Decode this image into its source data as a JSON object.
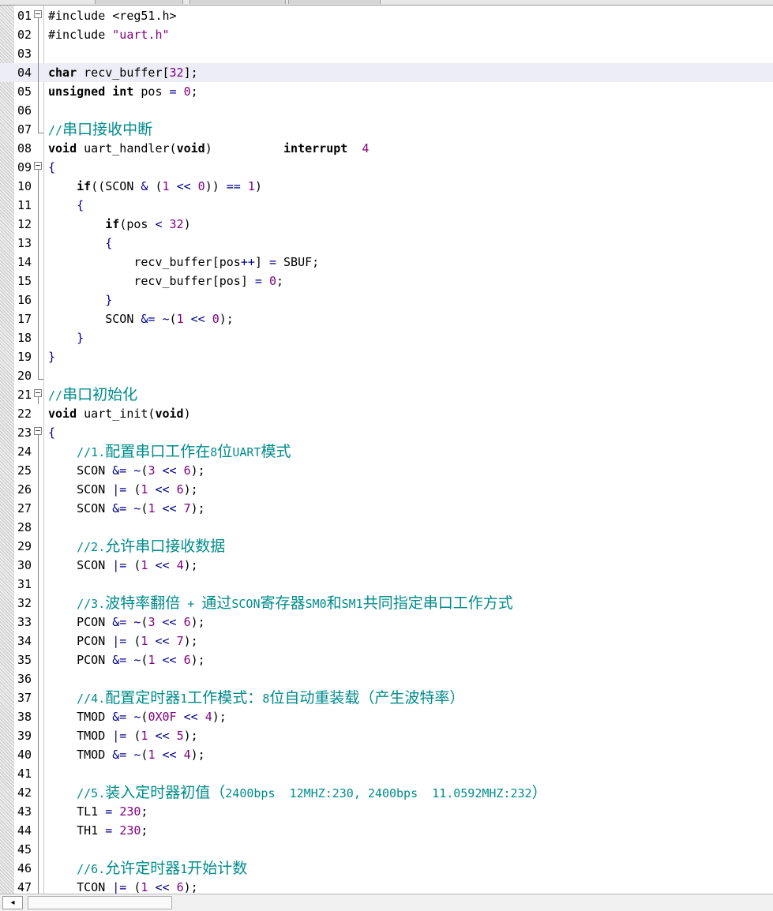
{
  "editor": {
    "lines": [
      {
        "n": "01",
        "fold": "box",
        "tokens": [
          [
            "#include",
            "pp"
          ],
          [
            " <reg51.h>",
            "pp"
          ]
        ]
      },
      {
        "n": "02",
        "fold": "line",
        "tokens": [
          [
            "#include",
            "pp"
          ],
          [
            " ",
            ""
          ],
          [
            "\"uart.h\"",
            "s"
          ]
        ]
      },
      {
        "n": "03",
        "fold": "line",
        "tokens": []
      },
      {
        "n": "04",
        "fold": "line",
        "hl": true,
        "tokens": [
          [
            "char",
            "k"
          ],
          [
            " recv_buffer[",
            ""
          ],
          [
            "32",
            "n"
          ],
          [
            "];",
            ""
          ]
        ]
      },
      {
        "n": "05",
        "fold": "line",
        "tokens": [
          [
            "unsigned",
            "k"
          ],
          [
            " ",
            ""
          ],
          [
            "int",
            "k"
          ],
          [
            " pos ",
            ""
          ],
          [
            "=",
            "o"
          ],
          [
            " ",
            ""
          ],
          [
            "0",
            "n"
          ],
          [
            ";",
            ""
          ]
        ]
      },
      {
        "n": "06",
        "fold": "line",
        "tokens": []
      },
      {
        "n": "07",
        "fold": "end",
        "tokens": [
          [
            "//串口接收中断",
            "c"
          ]
        ]
      },
      {
        "n": "08",
        "fold": "none",
        "tokens": [
          [
            "void",
            "k"
          ],
          [
            " uart_handler(",
            ""
          ],
          [
            "void",
            "k"
          ],
          [
            ")          ",
            ""
          ],
          [
            "interrupt",
            "k"
          ],
          [
            "  ",
            ""
          ],
          [
            "4",
            "n"
          ]
        ]
      },
      {
        "n": "09",
        "fold": "box",
        "tokens": [
          [
            "{",
            "o"
          ]
        ]
      },
      {
        "n": "10",
        "fold": "line",
        "tokens": [
          [
            "    ",
            ""
          ],
          [
            "if",
            "k"
          ],
          [
            "((SCON ",
            ""
          ],
          [
            "&",
            "o"
          ],
          [
            " (",
            ""
          ],
          [
            "1",
            "n"
          ],
          [
            " ",
            ""
          ],
          [
            "<<",
            "o"
          ],
          [
            " ",
            ""
          ],
          [
            "0",
            "n"
          ],
          [
            ")) ",
            ""
          ],
          [
            "==",
            "o"
          ],
          [
            " ",
            ""
          ],
          [
            "1",
            "n"
          ],
          [
            ")",
            ""
          ]
        ]
      },
      {
        "n": "11",
        "fold": "line",
        "tokens": [
          [
            "    ",
            ""
          ],
          [
            "{",
            "o"
          ]
        ]
      },
      {
        "n": "12",
        "fold": "line",
        "tokens": [
          [
            "        ",
            ""
          ],
          [
            "if",
            "k"
          ],
          [
            "(pos ",
            ""
          ],
          [
            "<",
            "o"
          ],
          [
            " ",
            ""
          ],
          [
            "32",
            "n"
          ],
          [
            ")",
            ""
          ]
        ]
      },
      {
        "n": "13",
        "fold": "line",
        "tokens": [
          [
            "        ",
            ""
          ],
          [
            "{",
            "o"
          ]
        ]
      },
      {
        "n": "14",
        "fold": "line",
        "tokens": [
          [
            "            recv_buffer[pos",
            ""
          ],
          [
            "++",
            "o"
          ],
          [
            "] ",
            ""
          ],
          [
            "=",
            "o"
          ],
          [
            " SBUF;",
            ""
          ]
        ]
      },
      {
        "n": "15",
        "fold": "line",
        "tokens": [
          [
            "            recv_buffer[pos] ",
            ""
          ],
          [
            "=",
            "o"
          ],
          [
            " ",
            ""
          ],
          [
            "0",
            "n"
          ],
          [
            ";",
            ""
          ]
        ]
      },
      {
        "n": "16",
        "fold": "line",
        "tokens": [
          [
            "        ",
            ""
          ],
          [
            "}",
            "o"
          ]
        ]
      },
      {
        "n": "17",
        "fold": "line",
        "tokens": [
          [
            "        SCON ",
            ""
          ],
          [
            "&=",
            "o"
          ],
          [
            " ",
            ""
          ],
          [
            "~",
            "o"
          ],
          [
            "(",
            ""
          ],
          [
            "1",
            "n"
          ],
          [
            " ",
            ""
          ],
          [
            "<<",
            "o"
          ],
          [
            " ",
            ""
          ],
          [
            "0",
            "n"
          ],
          [
            ");",
            ""
          ]
        ]
      },
      {
        "n": "18",
        "fold": "line",
        "tokens": [
          [
            "    ",
            ""
          ],
          [
            "}",
            "o"
          ]
        ]
      },
      {
        "n": "19",
        "fold": "line",
        "tokens": [
          [
            "}",
            "o"
          ]
        ]
      },
      {
        "n": "20",
        "fold": "end",
        "tokens": []
      },
      {
        "n": "21",
        "fold": "box",
        "tokens": [
          [
            "//串口初始化",
            "c"
          ]
        ]
      },
      {
        "n": "22",
        "fold": "none",
        "tokens": [
          [
            "void",
            "k"
          ],
          [
            " uart_init(",
            ""
          ],
          [
            "void",
            "k"
          ],
          [
            ")",
            ""
          ]
        ]
      },
      {
        "n": "23",
        "fold": "box",
        "tokens": [
          [
            "{",
            "o"
          ]
        ]
      },
      {
        "n": "24",
        "fold": "line",
        "tokens": [
          [
            "    ",
            ""
          ],
          [
            "//1.配置串口工作在8位UART模式",
            "c"
          ]
        ]
      },
      {
        "n": "25",
        "fold": "line",
        "tokens": [
          [
            "    SCON ",
            ""
          ],
          [
            "&=",
            "o"
          ],
          [
            " ",
            ""
          ],
          [
            "~",
            "o"
          ],
          [
            "(",
            ""
          ],
          [
            "3",
            "n"
          ],
          [
            " ",
            ""
          ],
          [
            "<<",
            "o"
          ],
          [
            " ",
            ""
          ],
          [
            "6",
            "n"
          ],
          [
            ");",
            ""
          ]
        ]
      },
      {
        "n": "26",
        "fold": "line",
        "tokens": [
          [
            "    SCON ",
            ""
          ],
          [
            "|=",
            "o"
          ],
          [
            " (",
            ""
          ],
          [
            "1",
            "n"
          ],
          [
            " ",
            ""
          ],
          [
            "<<",
            "o"
          ],
          [
            " ",
            ""
          ],
          [
            "6",
            "n"
          ],
          [
            ");",
            ""
          ]
        ]
      },
      {
        "n": "27",
        "fold": "line",
        "tokens": [
          [
            "    SCON ",
            ""
          ],
          [
            "&=",
            "o"
          ],
          [
            " ",
            ""
          ],
          [
            "~",
            "o"
          ],
          [
            "(",
            ""
          ],
          [
            "1",
            "n"
          ],
          [
            " ",
            ""
          ],
          [
            "<<",
            "o"
          ],
          [
            " ",
            ""
          ],
          [
            "7",
            "n"
          ],
          [
            ");",
            ""
          ]
        ]
      },
      {
        "n": "28",
        "fold": "line",
        "tokens": []
      },
      {
        "n": "29",
        "fold": "line",
        "tokens": [
          [
            "    ",
            ""
          ],
          [
            "//2.允许串口接收数据",
            "c"
          ]
        ]
      },
      {
        "n": "30",
        "fold": "line",
        "tokens": [
          [
            "    SCON ",
            ""
          ],
          [
            "|=",
            "o"
          ],
          [
            " (",
            ""
          ],
          [
            "1",
            "n"
          ],
          [
            " ",
            ""
          ],
          [
            "<<",
            "o"
          ],
          [
            " ",
            ""
          ],
          [
            "4",
            "n"
          ],
          [
            ");",
            ""
          ]
        ]
      },
      {
        "n": "31",
        "fold": "line",
        "tokens": []
      },
      {
        "n": "32",
        "fold": "line",
        "tokens": [
          [
            "    ",
            ""
          ],
          [
            "//3.波特率翻倍 + 通过SCON寄存器SM0和SM1共同指定串口工作方式",
            "c"
          ]
        ]
      },
      {
        "n": "33",
        "fold": "line",
        "tokens": [
          [
            "    PCON ",
            ""
          ],
          [
            "&=",
            "o"
          ],
          [
            " ",
            ""
          ],
          [
            "~",
            "o"
          ],
          [
            "(",
            ""
          ],
          [
            "3",
            "n"
          ],
          [
            " ",
            ""
          ],
          [
            "<<",
            "o"
          ],
          [
            " ",
            ""
          ],
          [
            "6",
            "n"
          ],
          [
            ");",
            ""
          ]
        ]
      },
      {
        "n": "34",
        "fold": "line",
        "tokens": [
          [
            "    PCON ",
            ""
          ],
          [
            "|=",
            "o"
          ],
          [
            " (",
            ""
          ],
          [
            "1",
            "n"
          ],
          [
            " ",
            ""
          ],
          [
            "<<",
            "o"
          ],
          [
            " ",
            ""
          ],
          [
            "7",
            "n"
          ],
          [
            ");",
            ""
          ]
        ]
      },
      {
        "n": "35",
        "fold": "line",
        "tokens": [
          [
            "    PCON ",
            ""
          ],
          [
            "&=",
            "o"
          ],
          [
            " ",
            ""
          ],
          [
            "~",
            "o"
          ],
          [
            "(",
            ""
          ],
          [
            "1",
            "n"
          ],
          [
            " ",
            ""
          ],
          [
            "<<",
            "o"
          ],
          [
            " ",
            ""
          ],
          [
            "6",
            "n"
          ],
          [
            ");",
            ""
          ]
        ]
      },
      {
        "n": "36",
        "fold": "line",
        "tokens": []
      },
      {
        "n": "37",
        "fold": "line",
        "tokens": [
          [
            "    ",
            ""
          ],
          [
            "//4.配置定时器1工作模式：8位自动重装载（产生波特率）",
            "c"
          ]
        ]
      },
      {
        "n": "38",
        "fold": "line",
        "tokens": [
          [
            "    TMOD ",
            ""
          ],
          [
            "&=",
            "o"
          ],
          [
            " ",
            ""
          ],
          [
            "~",
            "o"
          ],
          [
            "(",
            ""
          ],
          [
            "0X0F",
            "n"
          ],
          [
            " ",
            ""
          ],
          [
            "<<",
            "o"
          ],
          [
            " ",
            ""
          ],
          [
            "4",
            "n"
          ],
          [
            ");",
            ""
          ]
        ]
      },
      {
        "n": "39",
        "fold": "line",
        "tokens": [
          [
            "    TMOD ",
            ""
          ],
          [
            "|=",
            "o"
          ],
          [
            " (",
            ""
          ],
          [
            "1",
            "n"
          ],
          [
            " ",
            ""
          ],
          [
            "<<",
            "o"
          ],
          [
            " ",
            ""
          ],
          [
            "5",
            "n"
          ],
          [
            ");",
            ""
          ]
        ]
      },
      {
        "n": "40",
        "fold": "line",
        "tokens": [
          [
            "    TMOD ",
            ""
          ],
          [
            "&=",
            "o"
          ],
          [
            " ",
            ""
          ],
          [
            "~",
            "o"
          ],
          [
            "(",
            ""
          ],
          [
            "1",
            "n"
          ],
          [
            " ",
            ""
          ],
          [
            "<<",
            "o"
          ],
          [
            " ",
            ""
          ],
          [
            "4",
            "n"
          ],
          [
            ");",
            ""
          ]
        ]
      },
      {
        "n": "41",
        "fold": "line",
        "tokens": []
      },
      {
        "n": "42",
        "fold": "line",
        "tokens": [
          [
            "    ",
            ""
          ],
          [
            "//5.装入定时器初值（2400bps  12MHZ:230, 2400bps  11.0592MHZ:232）",
            "c"
          ]
        ]
      },
      {
        "n": "43",
        "fold": "line",
        "tokens": [
          [
            "    TL1 ",
            ""
          ],
          [
            "=",
            "o"
          ],
          [
            " ",
            ""
          ],
          [
            "230",
            "n"
          ],
          [
            ";",
            ""
          ]
        ]
      },
      {
        "n": "44",
        "fold": "line",
        "tokens": [
          [
            "    TH1 ",
            ""
          ],
          [
            "=",
            "o"
          ],
          [
            " ",
            ""
          ],
          [
            "230",
            "n"
          ],
          [
            ";",
            ""
          ]
        ]
      },
      {
        "n": "45",
        "fold": "line",
        "tokens": []
      },
      {
        "n": "46",
        "fold": "line",
        "tokens": [
          [
            "    ",
            ""
          ],
          [
            "//6.允许定时器1开始计数",
            "c"
          ]
        ]
      },
      {
        "n": "47",
        "fold": "line",
        "tokens": [
          [
            "    TCON ",
            ""
          ],
          [
            "|=",
            "o"
          ],
          [
            " (",
            ""
          ],
          [
            "1",
            "n"
          ],
          [
            " ",
            ""
          ],
          [
            "<<",
            "o"
          ],
          [
            " ",
            ""
          ],
          [
            "6",
            "n"
          ],
          [
            ");",
            ""
          ]
        ]
      }
    ]
  },
  "scrollbar": {
    "left_arrow_icon": "scroll-left-arrow-icon",
    "left_arrow_glyph": "◂"
  }
}
